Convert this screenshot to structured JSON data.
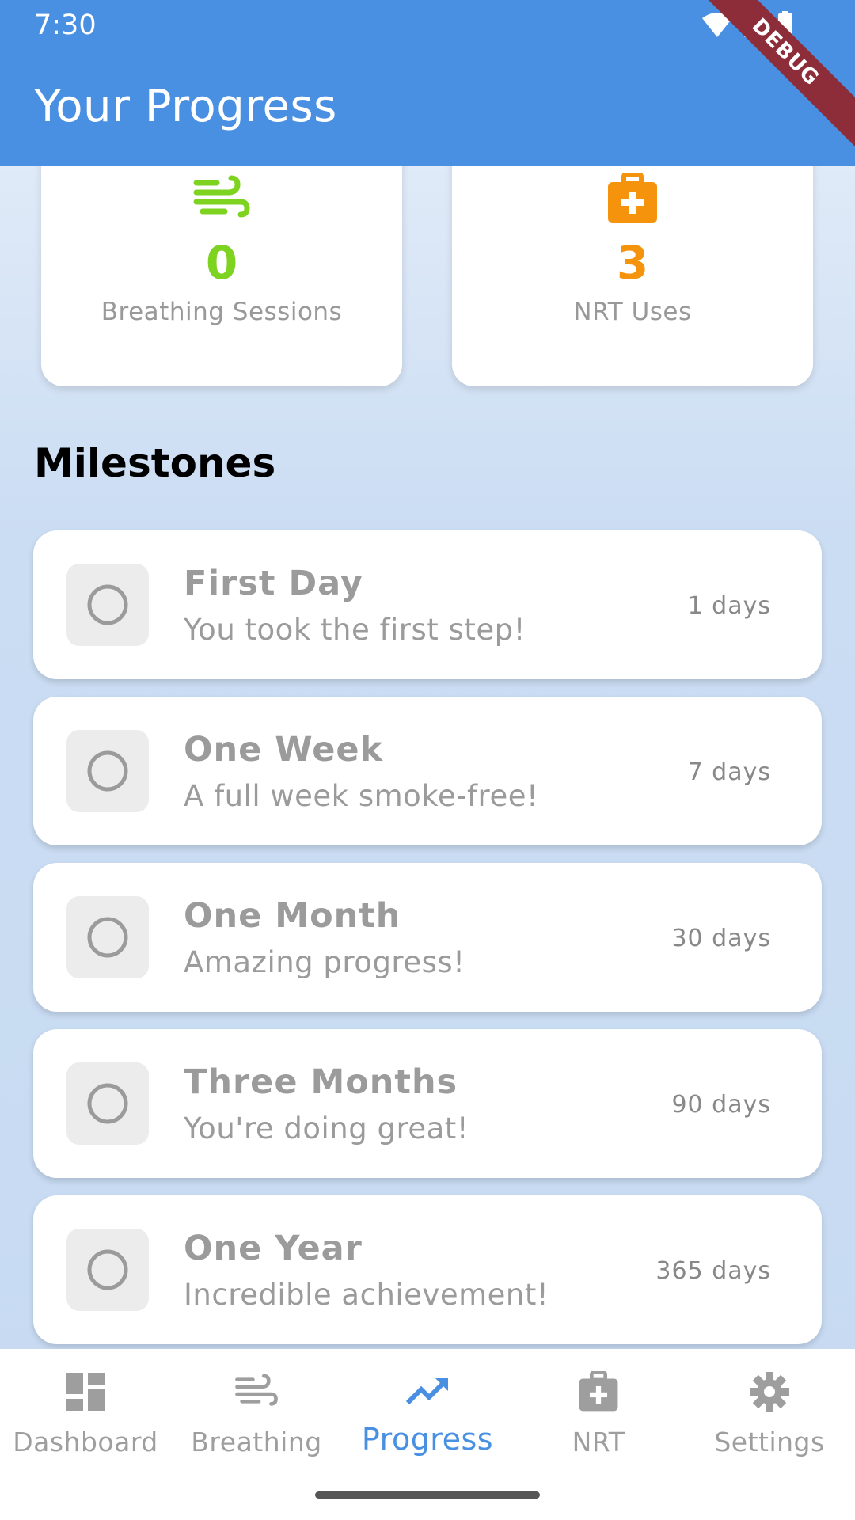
{
  "status_bar": {
    "time": "7:30"
  },
  "debug_banner": "DEBUG",
  "app_bar": {
    "title": "Your Progress"
  },
  "stats": [
    {
      "value": "0",
      "label": "Breathing Sessions",
      "icon": "wind-icon",
      "color": "#7ed321"
    },
    {
      "value": "3",
      "label": "NRT Uses",
      "icon": "medical-bag-icon",
      "color": "#f5940c"
    }
  ],
  "milestones_section": {
    "title": "Milestones",
    "items": [
      {
        "title": "First Day",
        "description": "You took the first step!",
        "days": "1 days"
      },
      {
        "title": "One Week",
        "description": "A full week smoke-free!",
        "days": "7 days"
      },
      {
        "title": "One Month",
        "description": "Amazing progress!",
        "days": "30 days"
      },
      {
        "title": "Three Months",
        "description": "You're doing great!",
        "days": "90 days"
      },
      {
        "title": "One Year",
        "description": "Incredible achievement!",
        "days": "365 days"
      }
    ]
  },
  "bottom_nav": {
    "items": [
      {
        "label": "Dashboard",
        "icon": "dashboard-icon"
      },
      {
        "label": "Breathing",
        "icon": "wind-icon"
      },
      {
        "label": "Progress",
        "icon": "trending-up-icon",
        "active": true
      },
      {
        "label": "NRT",
        "icon": "medical-bag-icon"
      },
      {
        "label": "Settings",
        "icon": "gear-icon"
      }
    ]
  },
  "colors": {
    "primary": "#4a90e2",
    "breathing_green": "#7ed321",
    "nrt_orange": "#f5940c",
    "inactive_gray": "#9e9e9e"
  }
}
